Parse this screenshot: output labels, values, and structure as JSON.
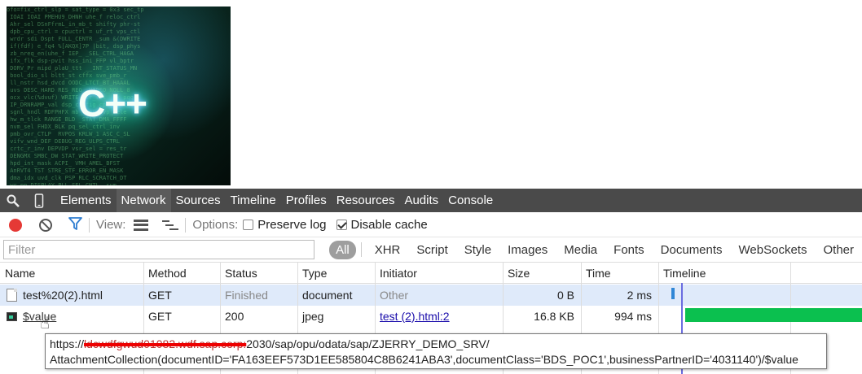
{
  "devtools": {
    "tabs": [
      "Elements",
      "Network",
      "Sources",
      "Timeline",
      "Profiles",
      "Resources",
      "Audits",
      "Console"
    ],
    "active_tab": "Network"
  },
  "toolbar": {
    "view_label": "View:",
    "options_label": "Options:",
    "preserve_log_label": "Preserve log",
    "preserve_log_checked": false,
    "disable_cache_label": "Disable cache",
    "disable_cache_checked": true
  },
  "filter": {
    "placeholder": "Filter",
    "active_type": "All",
    "types": [
      "XHR",
      "Script",
      "Style",
      "Images",
      "Media",
      "Fonts",
      "Documents",
      "WebSockets",
      "Other"
    ]
  },
  "table": {
    "columns": [
      "Name",
      "Method",
      "Status",
      "Type",
      "Initiator",
      "Size",
      "Time",
      "Timeline"
    ],
    "rows": [
      {
        "name": "test%20(2).html",
        "method": "GET",
        "status": "Finished",
        "type": "document",
        "initiator": "Other",
        "size": "0 B",
        "time": "2 ms"
      },
      {
        "name": "$value",
        "method": "GET",
        "status": "200",
        "type": "jpeg",
        "initiator": "test (2).html:2",
        "size": "16.8 KB",
        "time": "994 ms"
      }
    ]
  },
  "tooltip": {
    "line1_prefix": "https://",
    "line1_redacted": "ldcwdfgwud01082.wdf.sap.corp:",
    "line1_suffix": "2030/sap/opu/odata/sap/ZJERRY_DEMO_SRV/",
    "line2": "AttachmentCollection(documentID='FA163EEF573D1EE585804C8B6241ABA3',documentClass='BDS_POC1',businessPartnerID='4031140')/$value"
  },
  "preview": {
    "logo_text": "C++"
  },
  "colors": {
    "record": "#e53935",
    "timeline_bar": "#0bc04f",
    "selected_row": "#dfeafa"
  }
}
